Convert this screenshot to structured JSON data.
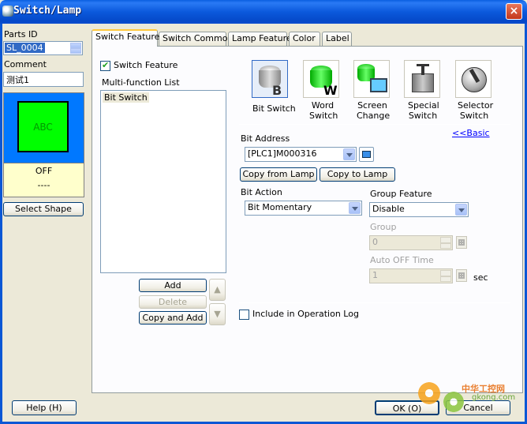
{
  "window": {
    "title": "Switch/Lamp",
    "close_icon": "×"
  },
  "left": {
    "parts_id_label": "Parts ID",
    "parts_id_value": "SL_0004",
    "comment_label": "Comment",
    "comment_value": "测试1",
    "preview": {
      "lamp_text": "ABC",
      "state_text": "OFF",
      "state_sub": "----",
      "lamp_color": "#00ff00",
      "bg_color": "#0078ff",
      "state_bg": "#ffffcc"
    },
    "select_shape_label": "Select Shape"
  },
  "tabs": [
    {
      "label": "Switch Feature"
    },
    {
      "label": "Switch Common"
    },
    {
      "label": "Lamp Feature"
    },
    {
      "label": "Color"
    },
    {
      "label": "Label"
    }
  ],
  "switch_feature": {
    "enable_label": "Switch Feature",
    "multi_list_label": "Multi-function List",
    "list_items": [
      "Bit Switch"
    ],
    "add_label": "Add",
    "delete_label": "Delete",
    "copy_add_label": "Copy and Add",
    "types": [
      {
        "label": "Bit Switch",
        "letter": "B"
      },
      {
        "label": "Word Switch",
        "letter": "W"
      },
      {
        "label": "Screen Change",
        "letter": ""
      },
      {
        "label": "Special Switch",
        "letter": ""
      },
      {
        "label": "Selector Switch",
        "letter": ""
      }
    ],
    "basic_link": "<<Basic",
    "bit_address_label": "Bit Address",
    "bit_address_value": "[PLC1]M000316",
    "copy_from_lamp": "Copy from Lamp",
    "copy_to_lamp": "Copy to Lamp",
    "bit_action_label": "Bit Action",
    "bit_action_value": "Bit Momentary",
    "group_feature_label": "Group Feature",
    "group_feature_value": "Disable",
    "group_label": "Group",
    "group_value": "0",
    "auto_off_label": "Auto OFF Time",
    "auto_off_value": "1",
    "auto_off_unit": "sec",
    "op_log_label": "Include in Operation Log"
  },
  "footer": {
    "help_label": "Help (H)",
    "ok_label": "OK (O)",
    "cancel_label": "Cancel"
  },
  "watermark": {
    "text_cn": "中华工控网",
    "text_url": "gkong.com"
  }
}
